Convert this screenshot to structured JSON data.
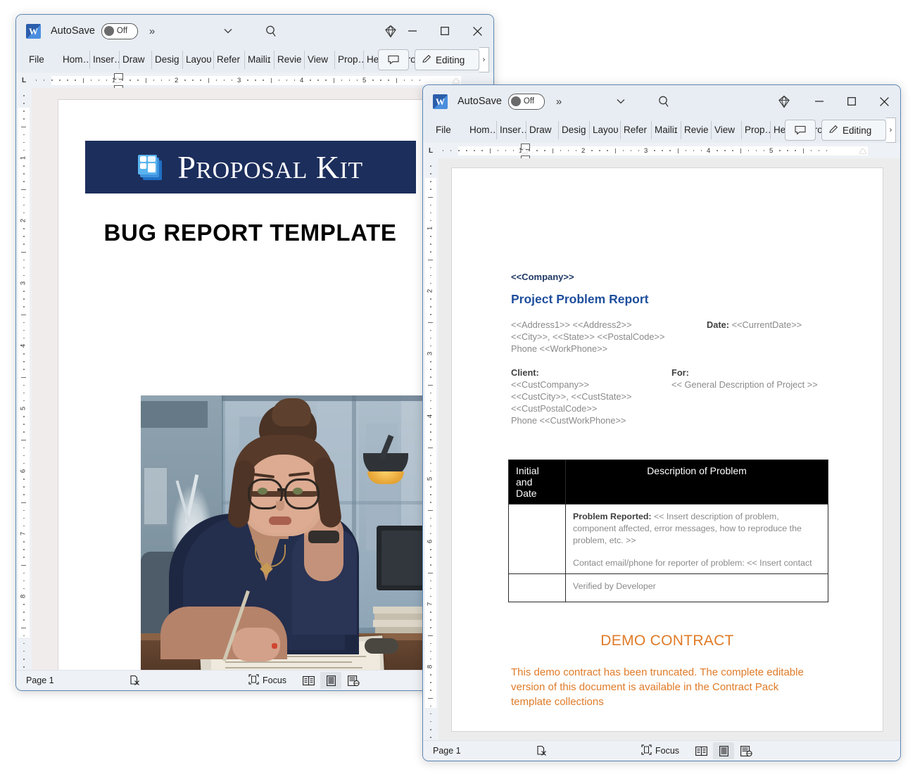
{
  "app": {
    "icon": "word-icon",
    "autosave_label": "AutoSave",
    "autosave_state": "Off",
    "qat_overflow": "»",
    "qat_chevron": "∨",
    "search_icon": "search-icon",
    "gem_icon": "diamond-icon",
    "minimize_icon": "minimize-icon",
    "maximize_icon": "maximize-icon",
    "close_icon": "close-icon"
  },
  "ribbon": {
    "tabs": [
      "File",
      "Hom…",
      "Inser…",
      "Draw",
      "Desiɡ",
      "Layoᴜ",
      "Refer",
      "Mailiɪ",
      "Revie",
      "View",
      "Prop…",
      "Help",
      "Acrol…"
    ],
    "comment_button": "comment-icon",
    "editing_label": "Editing",
    "editing_icon": "pencil-icon",
    "overflow_chevron": "›"
  },
  "ruler": {
    "origin_marker": "L",
    "numbers": [
      "1",
      "2",
      "3",
      "4",
      "5"
    ],
    "vertical_numbers": [
      "1",
      "2",
      "3",
      "4",
      "5",
      "6",
      "7",
      "8"
    ]
  },
  "statusbar": {
    "page": "Page 1",
    "proofing_icon": "proofing-error-icon",
    "focus_label": "Focus",
    "focus_icon": "focus-icon",
    "view_read": "read-mode-icon",
    "view_print": "print-layout-icon",
    "view_web": "web-layout-icon"
  },
  "window1": {
    "document": {
      "banner": {
        "brand_part1": "P",
        "brand_part1_rest": "ROPOSAL",
        "brand_part2": "K",
        "brand_part2_rest": "IT",
        "logo_icon": "proposal-kit-logo-icon",
        "background_color": "#1c2e5c",
        "text_color": "#ffffff"
      },
      "title": "BUG REPORT TEMPLATE",
      "illustration": "frustrated-office-worker-illustration"
    }
  },
  "window2": {
    "document": {
      "company": "<<Company>>",
      "heading": "Project Problem Report",
      "address_lines": [
        "<<Address1>> <<Address2>>",
        "<<City>>, <<State>> <<PostalCode>>",
        "Phone <<WorkPhone>>"
      ],
      "date_label": "Date:",
      "date_value": "<<CurrentDate>>",
      "client_label": "Client:",
      "client_lines": [
        "<<CustCompany>>",
        "<<CustCity>>, <<CustState>>",
        "<<CustPostalCode>>",
        "Phone <<CustWorkPhone>>"
      ],
      "for_label": "For:",
      "for_value": "<< General Description of Project >>",
      "table": {
        "header": [
          "Initial and Date",
          "Description of Problem"
        ],
        "header_col1_lines": [
          "Initial",
          "and",
          "Date"
        ],
        "rows": [
          {
            "initial": "",
            "desc_bold": "Problem Reported:",
            "desc_text": " << Insert description of problem, component affected, error messages, how to reproduce the problem, etc. >>",
            "desc_line2": "Contact email/phone for reporter of problem:  << Insert contact"
          },
          {
            "initial": "",
            "desc_bold": "",
            "desc_text": "Verified by Developer",
            "desc_line2": ""
          }
        ]
      },
      "demo_title": "DEMO CONTRACT",
      "demo_body": "This demo contract has been truncated. The complete editable version of this document is available in the Contract Pack template collections",
      "demo_color": "#e07b28"
    }
  }
}
